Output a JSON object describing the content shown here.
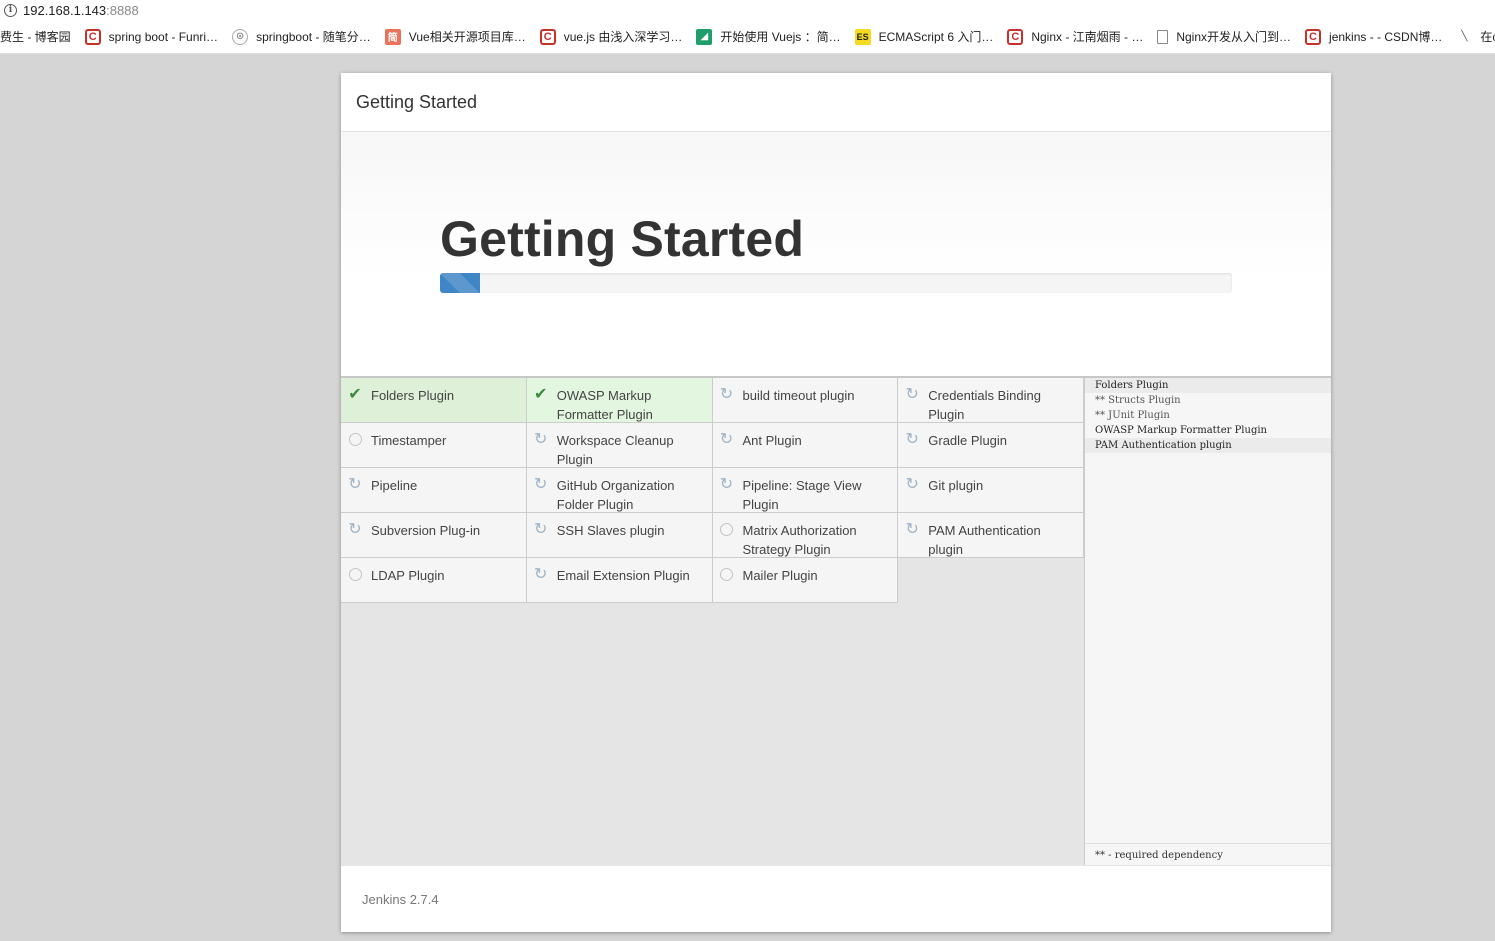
{
  "browser": {
    "url_host": "192.168.1.143",
    "url_port": ":8888",
    "bookmarks": [
      {
        "icon": "none",
        "label": "费生 - 博客园"
      },
      {
        "icon": "csdn",
        "label": "spring boot - Funri…"
      },
      {
        "icon": "bear",
        "label": "springboot - 随笔分…"
      },
      {
        "icon": "jian",
        "label": "Vue相关开源项目库…"
      },
      {
        "icon": "csdn",
        "label": "vue.js 由浅入深学习…"
      },
      {
        "icon": "vue",
        "label": "开始使用 Vuejs ：简…"
      },
      {
        "icon": "es",
        "label": "ECMAScript 6 入门…"
      },
      {
        "icon": "csdn",
        "label": "Nginx - 江南烟雨 - …"
      },
      {
        "icon": "doc",
        "label": "Nginx开发从入门到…"
      },
      {
        "icon": "csdn",
        "label": "jenkins - - CSDN博…"
      },
      {
        "icon": "vi",
        "label": "在cento…"
      }
    ]
  },
  "dialog": {
    "header_title": "Getting Started",
    "hero_title": "Getting Started",
    "progress_fraction": 0.05,
    "plugins": [
      {
        "name": "Folders Plugin",
        "status": "success"
      },
      {
        "name": "OWASP Markup Formatter Plugin",
        "status": "success"
      },
      {
        "name": "build timeout plugin",
        "status": "installing"
      },
      {
        "name": "Credentials Binding Plugin",
        "status": "installing"
      },
      {
        "name": "Timestamper",
        "status": "pending"
      },
      {
        "name": "Workspace Cleanup Plugin",
        "status": "installing"
      },
      {
        "name": "Ant Plugin",
        "status": "installing"
      },
      {
        "name": "Gradle Plugin",
        "status": "installing"
      },
      {
        "name": "Pipeline",
        "status": "installing"
      },
      {
        "name": "GitHub Organization Folder Plugin",
        "status": "installing"
      },
      {
        "name": "Pipeline: Stage View Plugin",
        "status": "installing"
      },
      {
        "name": "Git plugin",
        "status": "installing"
      },
      {
        "name": "Subversion Plug-in",
        "status": "installing"
      },
      {
        "name": "SSH Slaves plugin",
        "status": "installing"
      },
      {
        "name": "Matrix Authorization Strategy Plugin",
        "status": "pending"
      },
      {
        "name": "PAM Authentication plugin",
        "status": "installing"
      },
      {
        "name": "LDAP Plugin",
        "status": "pending"
      },
      {
        "name": "Email Extension Plugin",
        "status": "installing"
      },
      {
        "name": "Mailer Plugin",
        "status": "pending"
      }
    ],
    "log_lines": [
      {
        "text": "Folders Plugin",
        "highlight": true,
        "dependency": false
      },
      {
        "text": "** Structs Plugin",
        "highlight": false,
        "dependency": true
      },
      {
        "text": "** JUnit Plugin",
        "highlight": false,
        "dependency": true
      },
      {
        "text": "OWASP Markup Formatter Plugin",
        "highlight": false,
        "dependency": false
      },
      {
        "text": "PAM Authentication plugin",
        "highlight": true,
        "dependency": false
      }
    ],
    "log_legend": "** - required dependency",
    "footer_version": "Jenkins 2.7.4"
  }
}
